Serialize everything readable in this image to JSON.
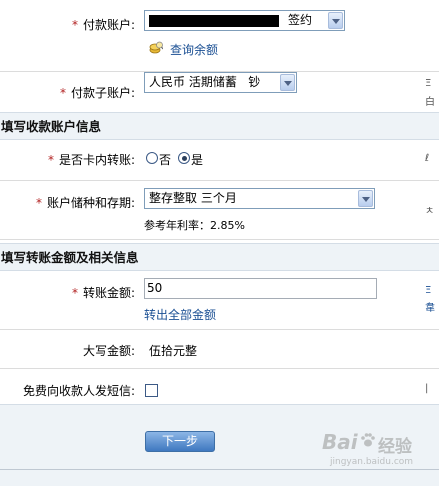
{
  "payment_account": {
    "label": "付款账户:",
    "value_suffix": "签约",
    "query_balance_link": "查询余额"
  },
  "sub_account": {
    "label": "付款子账户:",
    "value": "人民币 活期储蓄   钞"
  },
  "section_payee": {
    "title": "填写收款账户信息"
  },
  "intra_card_transfer": {
    "label": "是否卡内转账:",
    "options": [
      "否",
      "是"
    ],
    "selected": "是"
  },
  "deposit_type": {
    "label": "账户储种和存期:",
    "value": "整存整取 三个月",
    "rate_text": "参考年利率：2.85%"
  },
  "section_amount": {
    "title": "填写转账金额及相关信息"
  },
  "transfer_amount": {
    "label": "转账金额:",
    "value": "50",
    "transfer_all_link": "转出全部金额"
  },
  "amount_in_words": {
    "label": "大写金额:",
    "value": "伍拾元整"
  },
  "free_sms": {
    "label": "免费向收款人发短信:",
    "checked": false
  },
  "next_button": {
    "label": "下一步"
  },
  "watermark": {
    "brand": "Bai",
    "text": "经验",
    "url": "jingyan.baidu.com"
  }
}
